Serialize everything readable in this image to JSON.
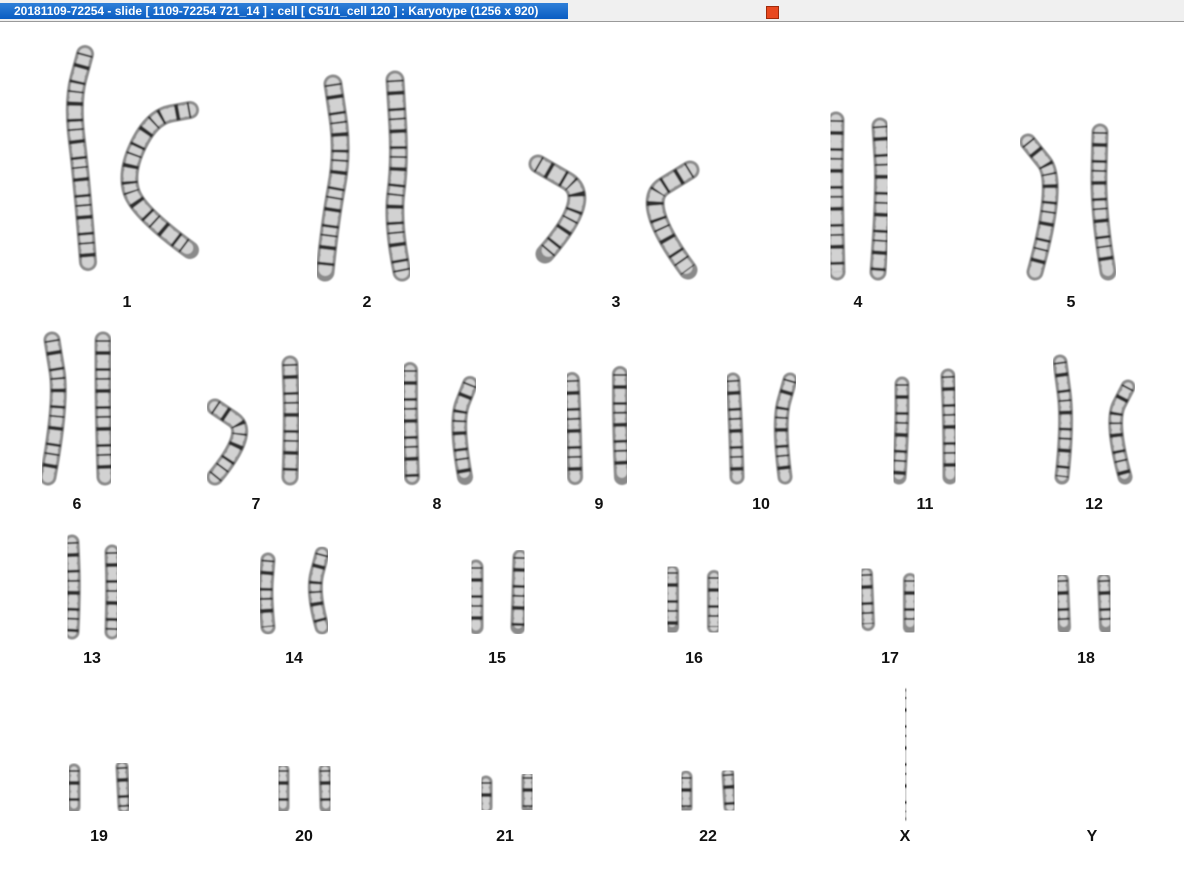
{
  "window": {
    "title": "20181109-72254 - slide [ 1109-72254 721_14 ] : cell [ C51/1_cell 120 ] : Karyotype  (1256 x 920)"
  },
  "karyotype": {
    "chromosomes": [
      {
        "label": "1"
      },
      {
        "label": "2"
      },
      {
        "label": "3"
      },
      {
        "label": "4"
      },
      {
        "label": "5"
      },
      {
        "label": "6"
      },
      {
        "label": "7"
      },
      {
        "label": "8"
      },
      {
        "label": "9"
      },
      {
        "label": "10"
      },
      {
        "label": "11"
      },
      {
        "label": "12"
      },
      {
        "label": "13"
      },
      {
        "label": "14"
      },
      {
        "label": "15"
      },
      {
        "label": "16"
      },
      {
        "label": "17"
      },
      {
        "label": "18"
      },
      {
        "label": "19"
      },
      {
        "label": "20"
      },
      {
        "label": "21"
      },
      {
        "label": "22"
      },
      {
        "label": "X"
      },
      {
        "label": "Y"
      }
    ]
  }
}
